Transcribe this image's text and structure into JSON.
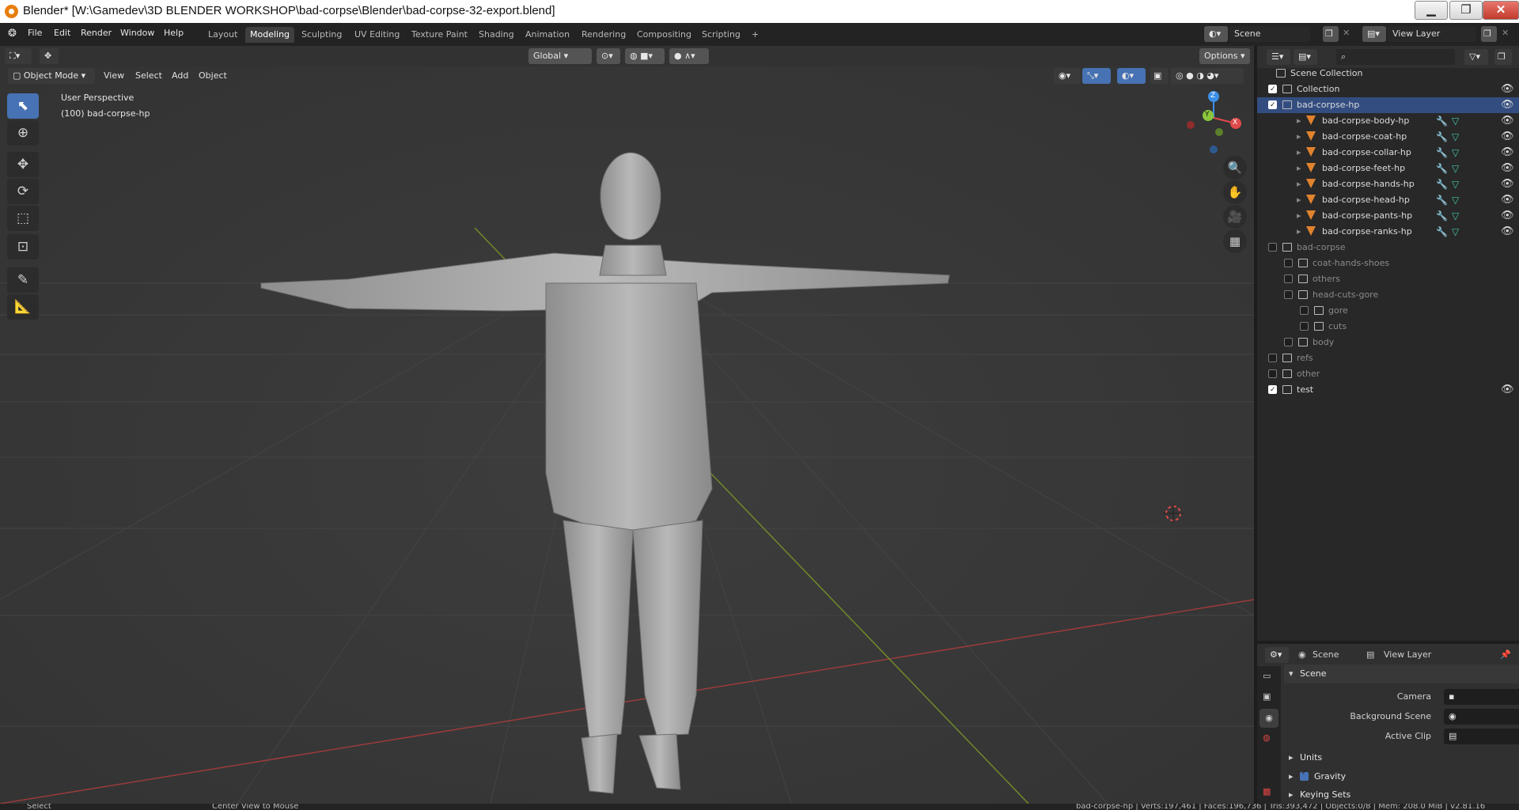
{
  "window": {
    "title": "Blender* [W:\\Gamedev\\3D BLENDER WORKSHOP\\bad-corpse\\Blender\\bad-corpse-32-export.blend]",
    "min": "▁",
    "max": "❐",
    "close": "✕"
  },
  "menu": [
    "File",
    "Edit",
    "Render",
    "Window",
    "Help"
  ],
  "workspaces": [
    "Layout",
    "Modeling",
    "Sculpting",
    "UV Editing",
    "Texture Paint",
    "Shading",
    "Animation",
    "Rendering",
    "Compositing",
    "Scripting",
    "+"
  ],
  "active_workspace": "Modeling",
  "scene": {
    "name": "Scene",
    "view_layer": "View Layer"
  },
  "viewport": {
    "orientation": "Global",
    "options": "Options",
    "mode": "Object Mode",
    "menus": [
      "View",
      "Select",
      "Add",
      "Object"
    ],
    "overlay_line1": "User Perspective",
    "overlay_line2": "(100) bad-corpse-hp"
  },
  "gizmo": {
    "z": "Z",
    "y": "Y",
    "x": "X"
  },
  "outliner": {
    "root": "Scene Collection",
    "rows": [
      {
        "label": "Collection",
        "check": true,
        "eye": true,
        "dim": false,
        "type": "coll",
        "indent": 0
      },
      {
        "label": "bad-corpse-hp",
        "check": true,
        "eye": true,
        "dim": false,
        "type": "coll",
        "indent": 0,
        "selected": true
      },
      {
        "label": "bad-corpse-body-hp",
        "type": "mesh",
        "indent": 1,
        "eye": true
      },
      {
        "label": "bad-corpse-coat-hp",
        "type": "mesh",
        "indent": 1,
        "eye": true
      },
      {
        "label": "bad-corpse-collar-hp",
        "type": "mesh",
        "indent": 1,
        "eye": true
      },
      {
        "label": "bad-corpse-feet-hp",
        "type": "mesh",
        "indent": 1,
        "eye": true
      },
      {
        "label": "bad-corpse-hands-hp",
        "type": "mesh",
        "indent": 1,
        "eye": true
      },
      {
        "label": "bad-corpse-head-hp",
        "type": "mesh",
        "indent": 1,
        "eye": true
      },
      {
        "label": "bad-corpse-pants-hp",
        "type": "mesh",
        "indent": 1,
        "eye": true
      },
      {
        "label": "bad-corpse-ranks-hp",
        "type": "mesh",
        "indent": 1,
        "eye": true
      },
      {
        "label": "bad-corpse",
        "check": false,
        "dim": true,
        "type": "coll",
        "indent": 0
      },
      {
        "label": "coat-hands-shoes",
        "check": false,
        "dim": true,
        "type": "coll",
        "indent": 1
      },
      {
        "label": "others",
        "check": false,
        "dim": true,
        "type": "coll",
        "indent": 1
      },
      {
        "label": "head-cuts-gore",
        "check": false,
        "dim": true,
        "type": "coll",
        "indent": 1
      },
      {
        "label": "gore",
        "check": false,
        "dim": true,
        "type": "coll",
        "indent": 2
      },
      {
        "label": "cuts",
        "check": false,
        "dim": true,
        "type": "coll",
        "indent": 2
      },
      {
        "label": "body",
        "check": false,
        "dim": true,
        "type": "coll",
        "indent": 1
      },
      {
        "label": "refs",
        "check": false,
        "dim": true,
        "type": "coll",
        "indent": 0
      },
      {
        "label": "other",
        "check": false,
        "dim": true,
        "type": "coll",
        "indent": 0
      },
      {
        "label": "test",
        "check": true,
        "eye": true,
        "dim": false,
        "type": "coll",
        "indent": 0
      }
    ]
  },
  "properties": {
    "scene": "Scene",
    "view_layer": "View Layer",
    "section": "Scene",
    "camera": "Camera",
    "background_scene": "Background Scene",
    "active_clip": "Active Clip",
    "units": "Units",
    "gravity": "Gravity",
    "keying_sets": "Keying Sets"
  },
  "status": {
    "left": "Select",
    "mid": "Center View to Mouse",
    "right": "bad-corpse-hp | Verts:197,461 | Faces:196,736 | Tris:393,472 | Objects:0/8 | Mem: 208.0 MiB | v2.81.16"
  },
  "colors": {
    "accent": "#4772b3",
    "axis_x": "#e04a4a",
    "axis_y": "#8bc63c",
    "axis_z": "#3b8fe8",
    "mesh": "#e0822e"
  }
}
